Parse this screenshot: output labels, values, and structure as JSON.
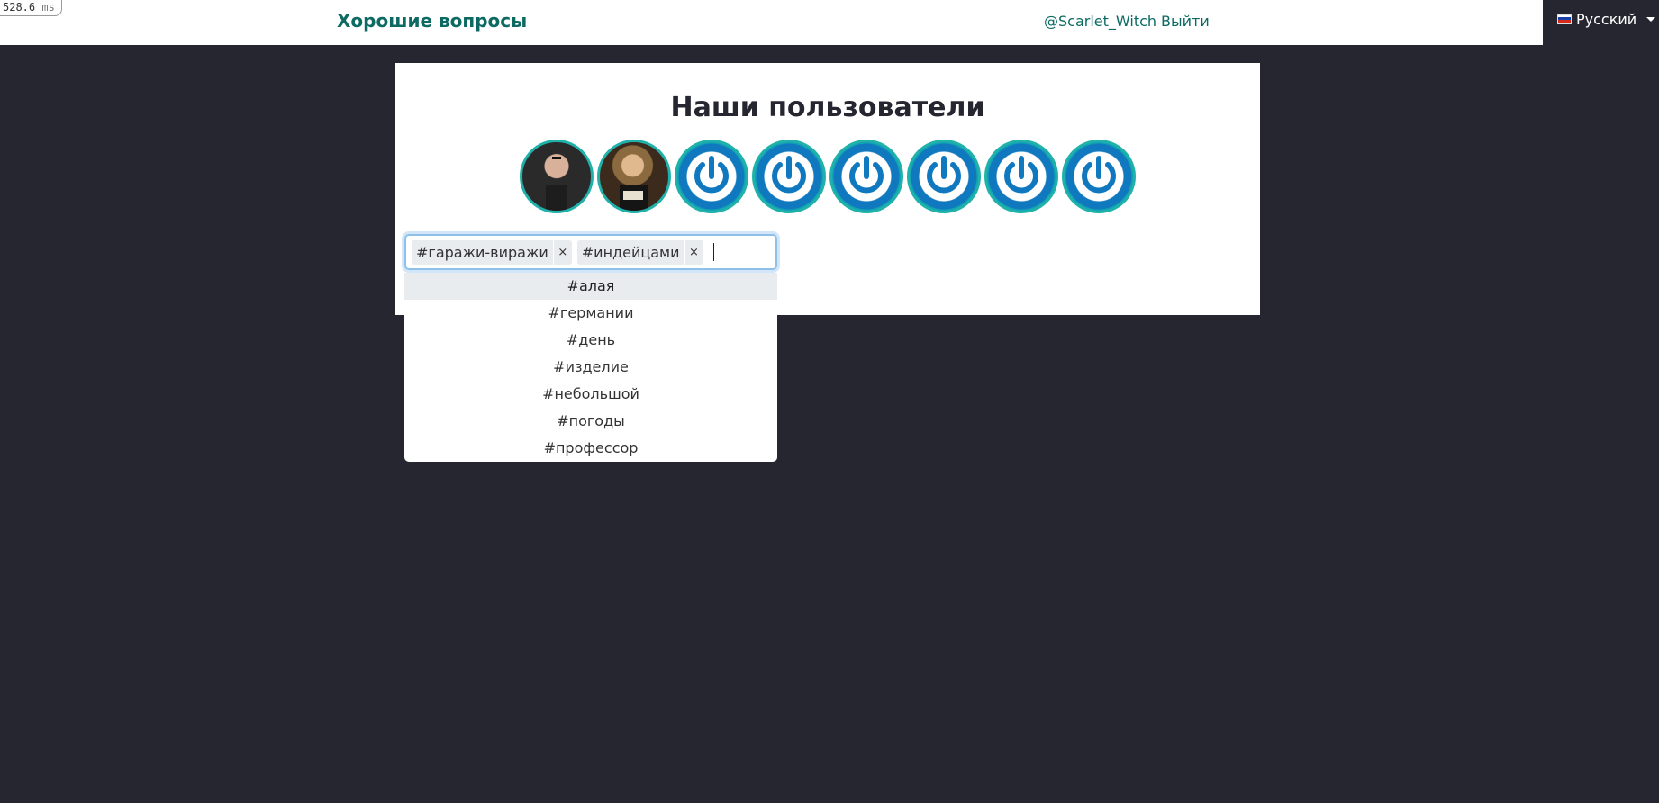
{
  "timer": {
    "value": "528.6",
    "unit": "ms"
  },
  "navbar": {
    "brand": "Хорошие вопросы",
    "user": "@Scarlet_Witch",
    "logout": "Выйти",
    "language": "Русский"
  },
  "main": {
    "title": "Наши пользователи",
    "avatars": [
      {
        "kind": "photo"
      },
      {
        "kind": "photo"
      },
      {
        "kind": "power-icon"
      },
      {
        "kind": "power-icon"
      },
      {
        "kind": "power-icon"
      },
      {
        "kind": "power-icon"
      },
      {
        "kind": "power-icon"
      },
      {
        "kind": "power-icon"
      }
    ],
    "tag_input": {
      "selected_tags": [
        "#гаражи-виражи",
        "#индейцами"
      ],
      "remove_symbol": "×"
    },
    "suggestions": [
      "#алая",
      "#германии",
      "#день",
      "#изделие",
      "#небольшой",
      "#погоды",
      "#профессор"
    ]
  },
  "colors": {
    "accent": "#0d6a63",
    "background": "#262631",
    "avatar_border": "#20b2aa",
    "power_blue": "#0f78be"
  }
}
